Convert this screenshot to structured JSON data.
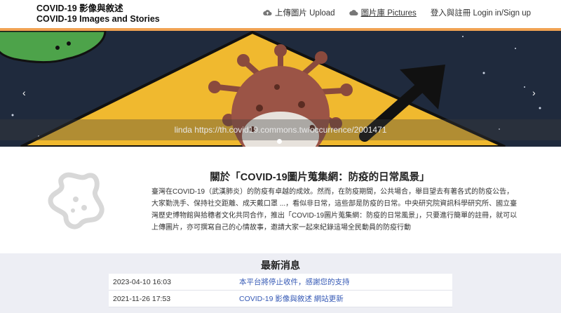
{
  "header": {
    "title_zh": "COVID-19 影像與敘述",
    "title_en": "COVID-19 Images and Stories",
    "nav": [
      {
        "label": "上傳圖片 Upload",
        "icon": "cloud-upload-icon"
      },
      {
        "label": "圖片庫 Pictures",
        "icon": "cloud-icon"
      },
      {
        "label": "登入與註冊 Login in/Sign up"
      }
    ]
  },
  "carousel": {
    "caption": "linda https://th.covid19.commons.tw/occurrence/2001471",
    "prev": "‹",
    "next": "›"
  },
  "about": {
    "title": "關於「COVID-19圖片蒐集網：防疫的日常風景」",
    "body": "臺灣在COVID-19（武漢肺炎）的防疫有卓越的成效。然而，在防疫期間，公共場合，舉目望去有著各式的防疫公告，大家勤洗手、保持社交距離、成天戴口罩 ...，看似非日常，這些部是防疫的日常。中央研究院資訊科學研究所、國立臺灣歷史博物館與拾穗者文化共同合作，推出「COVID-19圖片蒐集網：防疫的日常風景」，只要進行簡單的註冊，就可以上傳圖片，亦可撰寫自己的心情故事，邀請大家一起來紀錄這場全民動員的防疫行動"
  },
  "news": {
    "title": "最新消息",
    "items": [
      {
        "date": "2023-04-10 16:03",
        "text": "本平台將停止收件，感謝您的支持"
      },
      {
        "date": "2021-11-26 17:53",
        "text": "COVID-19 影像與敘述 網站更新"
      }
    ]
  },
  "colors": {
    "accent": "#f0a253",
    "link": "#3559b5",
    "news_bg": "#edeef4"
  }
}
